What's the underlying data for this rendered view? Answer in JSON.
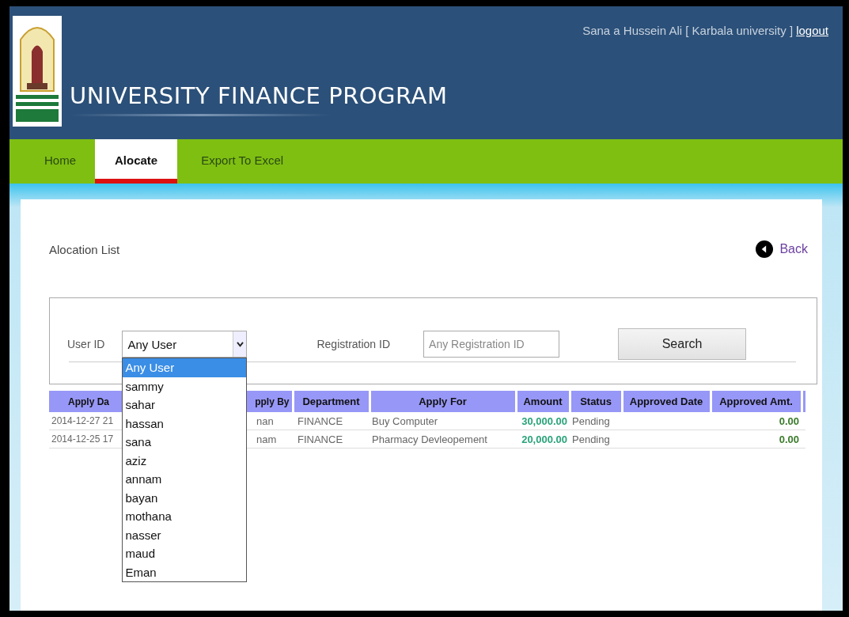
{
  "header": {
    "title": "UNIVERSITY FINANCE PROGRAM",
    "user": "Sana a Hussein Ali [ Karbala university ]",
    "logout": "logout"
  },
  "nav": [
    {
      "label": "Home",
      "selected": false
    },
    {
      "label": "Alocate",
      "selected": true
    },
    {
      "label": "Export To Excel",
      "selected": false
    }
  ],
  "page_title": "Alocation List",
  "back": "Back",
  "filters": {
    "user_id_label": "User ID",
    "user_select": {
      "value": "Any User",
      "expanded": true,
      "options": [
        {
          "label": "Any User",
          "selected": true
        },
        {
          "label": "sammy",
          "selected": false
        },
        {
          "label": "sahar",
          "selected": false
        },
        {
          "label": "hassan",
          "selected": false
        },
        {
          "label": "sana",
          "selected": false
        },
        {
          "label": "aziz",
          "selected": false
        },
        {
          "label": "annam",
          "selected": false
        },
        {
          "label": "bayan",
          "selected": false
        },
        {
          "label": "mothana",
          "selected": false
        },
        {
          "label": "nasser",
          "selected": false
        },
        {
          "label": "maud",
          "selected": false
        },
        {
          "label": "Eman",
          "selected": false
        }
      ]
    },
    "registration_label": "Registration ID",
    "registration_input": {
      "placeholder": "Any Registration ID"
    },
    "search_button": "Search"
  },
  "table": {
    "columns": [
      "Apply Da",
      "pply By",
      "Department",
      "Apply For",
      "Amount",
      "Status",
      "Approved Date",
      "Approved Amt."
    ],
    "rows": [
      {
        "apply_date": "2014-12-27 21",
        "apply_by": "nan",
        "department": "FINANCE",
        "apply_for": "Buy Computer",
        "amount": "30,000.00",
        "status": "Pending",
        "approved_amt": "0.00"
      },
      {
        "apply_date": "2014-12-25 17",
        "apply_by": "nam",
        "department": "FINANCE",
        "apply_for": "Pharmacy Devleopement",
        "amount": "20,000.00",
        "status": "Pending",
        "approved_amt": "0.00"
      }
    ]
  }
}
